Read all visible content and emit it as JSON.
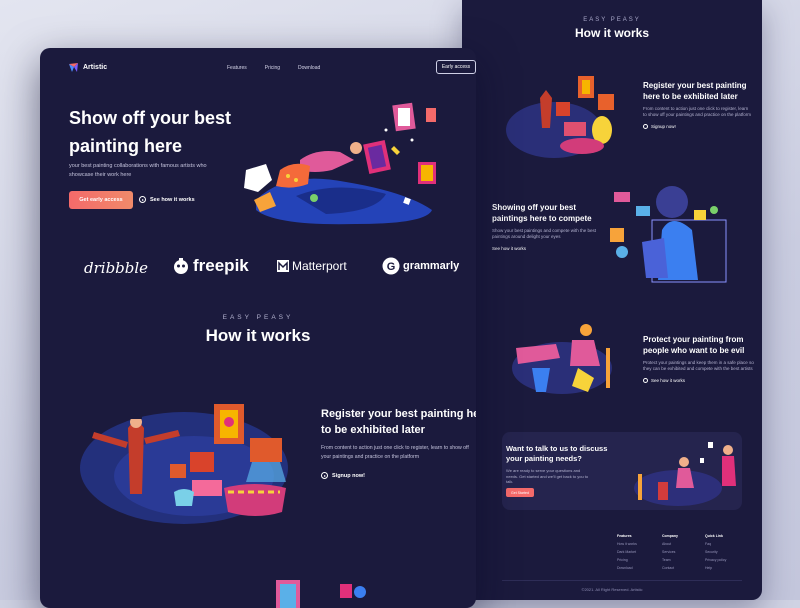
{
  "front": {
    "brand": "Artistic",
    "nav": [
      "Features",
      "Pricing",
      "Download"
    ],
    "nav_cta": "Early access",
    "hero": {
      "title": "Show off your best painting here",
      "subtitle": "your best painting collaborations with famous artists who showcase their work here",
      "primary_button": "Get early access",
      "secondary_link": "See how it works"
    },
    "brands": [
      "dribbble",
      "freepik",
      "Matterport",
      "grammarly"
    ],
    "how": {
      "eyebrow": "EASY PEASY",
      "title": "How it works",
      "step1": {
        "title": "Register your best painting here to be exhibited later",
        "description": "From content to action just one click to register, learn to show off your paintings and practice on the platform",
        "link": "Signup now!"
      }
    }
  },
  "back": {
    "eyebrow": "EASY PEASY",
    "title": "How it works",
    "steps": [
      {
        "title": "Register your best painting here to be exhibited later",
        "description": "From content to action just one click to register, learn to show off your paintings and practice on the platform",
        "link": "Signup now!"
      },
      {
        "title": "Showing off your best paintings here to compete",
        "description": "Show your best paintings and compete with the best paintings around delight your eyes",
        "link": "See how it works"
      },
      {
        "title": "Protect your painting from people who want to be evil",
        "description": "Protect your paintings and keep them in a safe place so they can be exhibited and compete with the best artists",
        "link": "See how it works"
      }
    ],
    "cta": {
      "title": "Want to talk to us to discuss your painting needs?",
      "description": "We are ready to serve your questions and needs. Get started and we'll get back to you to talk.",
      "button": "Get Started"
    },
    "footer": {
      "columns": [
        {
          "heading": "Features",
          "items": [
            "How it works",
            "Dark Market",
            "Pricing",
            "Download"
          ]
        },
        {
          "heading": "Company",
          "items": [
            "About",
            "Services",
            "Team",
            "Contact"
          ]
        },
        {
          "heading": "Quick Link",
          "items": [
            "Faq",
            "Security",
            "Privacy policy",
            "Help"
          ]
        }
      ],
      "copyright": "©2021. All Right Reserved. Artistic"
    }
  },
  "colors": {
    "page_bg": "#1b1a3d",
    "accent": "#f46a6a",
    "card": "#25244e"
  }
}
